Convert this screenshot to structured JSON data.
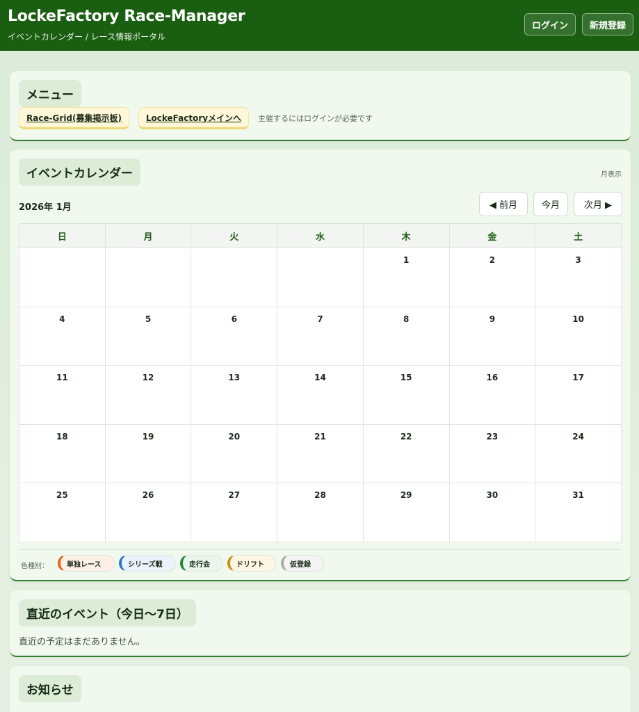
{
  "header": {
    "title": "LockeFactory Race-Manager",
    "subtitle": "イベントカレンダー / レース情報ポータル",
    "login_label": "ログイン",
    "register_label": "新規登録"
  },
  "menu": {
    "title": "メニュー",
    "links": [
      "Race-Grid(募集掲示板)",
      "LockeFactoryメインへ"
    ],
    "note": "主催するにはログインが必要です"
  },
  "calendar": {
    "title": "イベントカレンダー",
    "view_label": "月表示",
    "month_label": "2026年 1月",
    "prev_label": "◀ 前月",
    "today_label": "今月",
    "next_label": "次月 ▶",
    "weekdays": [
      "日",
      "月",
      "火",
      "水",
      "木",
      "金",
      "土"
    ],
    "weeks": [
      [
        "",
        "",
        "",
        "",
        "1",
        "2",
        "3"
      ],
      [
        "4",
        "5",
        "6",
        "7",
        "8",
        "9",
        "10"
      ],
      [
        "11",
        "12",
        "13",
        "14",
        "15",
        "16",
        "17"
      ],
      [
        "18",
        "19",
        "20",
        "21",
        "22",
        "23",
        "24"
      ],
      [
        "25",
        "26",
        "27",
        "28",
        "29",
        "30",
        "31"
      ]
    ],
    "legend_label": "色種別：",
    "legend": [
      {
        "label": "単独レース",
        "color": "#e8651c",
        "bg": "#fdf0e6"
      },
      {
        "label": "シリーズ戦",
        "color": "#2f76c4",
        "bg": "#eaf2fb"
      },
      {
        "label": "走行会",
        "color": "#1f8a3a",
        "bg": "#eaf6ec"
      },
      {
        "label": "ドリフト",
        "color": "#c9900f",
        "bg": "#fdf6e2"
      },
      {
        "label": "仮登録",
        "color": "#a8aca8",
        "bg": "#f3f4f3"
      }
    ]
  },
  "upcoming": {
    "title": "直近のイベント（今日〜7日）",
    "empty_text": "直近の予定はまだありません。"
  },
  "news": {
    "title": "お知らせ"
  },
  "colors": {
    "header_bg": "#1a5e12",
    "card_bg": "#f1f8ee",
    "accent": "#2f7d24"
  }
}
